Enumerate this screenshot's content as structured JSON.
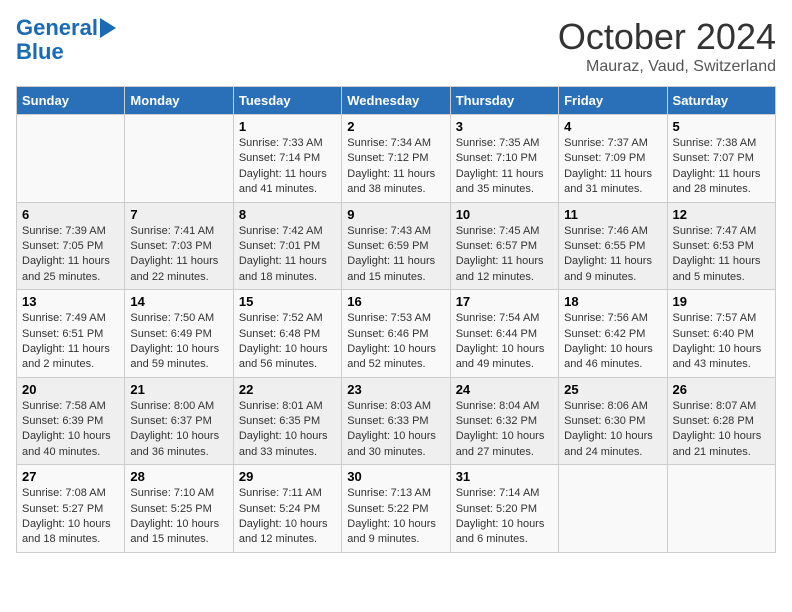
{
  "header": {
    "logo_line1": "General",
    "logo_line2": "Blue",
    "month": "October 2024",
    "location": "Mauraz, Vaud, Switzerland"
  },
  "days_of_week": [
    "Sunday",
    "Monday",
    "Tuesday",
    "Wednesday",
    "Thursday",
    "Friday",
    "Saturday"
  ],
  "weeks": [
    [
      {
        "day": "",
        "sunrise": "",
        "sunset": "",
        "daylight": ""
      },
      {
        "day": "",
        "sunrise": "",
        "sunset": "",
        "daylight": ""
      },
      {
        "day": "1",
        "sunrise": "Sunrise: 7:33 AM",
        "sunset": "Sunset: 7:14 PM",
        "daylight": "Daylight: 11 hours and 41 minutes."
      },
      {
        "day": "2",
        "sunrise": "Sunrise: 7:34 AM",
        "sunset": "Sunset: 7:12 PM",
        "daylight": "Daylight: 11 hours and 38 minutes."
      },
      {
        "day": "3",
        "sunrise": "Sunrise: 7:35 AM",
        "sunset": "Sunset: 7:10 PM",
        "daylight": "Daylight: 11 hours and 35 minutes."
      },
      {
        "day": "4",
        "sunrise": "Sunrise: 7:37 AM",
        "sunset": "Sunset: 7:09 PM",
        "daylight": "Daylight: 11 hours and 31 minutes."
      },
      {
        "day": "5",
        "sunrise": "Sunrise: 7:38 AM",
        "sunset": "Sunset: 7:07 PM",
        "daylight": "Daylight: 11 hours and 28 minutes."
      }
    ],
    [
      {
        "day": "6",
        "sunrise": "Sunrise: 7:39 AM",
        "sunset": "Sunset: 7:05 PM",
        "daylight": "Daylight: 11 hours and 25 minutes."
      },
      {
        "day": "7",
        "sunrise": "Sunrise: 7:41 AM",
        "sunset": "Sunset: 7:03 PM",
        "daylight": "Daylight: 11 hours and 22 minutes."
      },
      {
        "day": "8",
        "sunrise": "Sunrise: 7:42 AM",
        "sunset": "Sunset: 7:01 PM",
        "daylight": "Daylight: 11 hours and 18 minutes."
      },
      {
        "day": "9",
        "sunrise": "Sunrise: 7:43 AM",
        "sunset": "Sunset: 6:59 PM",
        "daylight": "Daylight: 11 hours and 15 minutes."
      },
      {
        "day": "10",
        "sunrise": "Sunrise: 7:45 AM",
        "sunset": "Sunset: 6:57 PM",
        "daylight": "Daylight: 11 hours and 12 minutes."
      },
      {
        "day": "11",
        "sunrise": "Sunrise: 7:46 AM",
        "sunset": "Sunset: 6:55 PM",
        "daylight": "Daylight: 11 hours and 9 minutes."
      },
      {
        "day": "12",
        "sunrise": "Sunrise: 7:47 AM",
        "sunset": "Sunset: 6:53 PM",
        "daylight": "Daylight: 11 hours and 5 minutes."
      }
    ],
    [
      {
        "day": "13",
        "sunrise": "Sunrise: 7:49 AM",
        "sunset": "Sunset: 6:51 PM",
        "daylight": "Daylight: 11 hours and 2 minutes."
      },
      {
        "day": "14",
        "sunrise": "Sunrise: 7:50 AM",
        "sunset": "Sunset: 6:49 PM",
        "daylight": "Daylight: 10 hours and 59 minutes."
      },
      {
        "day": "15",
        "sunrise": "Sunrise: 7:52 AM",
        "sunset": "Sunset: 6:48 PM",
        "daylight": "Daylight: 10 hours and 56 minutes."
      },
      {
        "day": "16",
        "sunrise": "Sunrise: 7:53 AM",
        "sunset": "Sunset: 6:46 PM",
        "daylight": "Daylight: 10 hours and 52 minutes."
      },
      {
        "day": "17",
        "sunrise": "Sunrise: 7:54 AM",
        "sunset": "Sunset: 6:44 PM",
        "daylight": "Daylight: 10 hours and 49 minutes."
      },
      {
        "day": "18",
        "sunrise": "Sunrise: 7:56 AM",
        "sunset": "Sunset: 6:42 PM",
        "daylight": "Daylight: 10 hours and 46 minutes."
      },
      {
        "day": "19",
        "sunrise": "Sunrise: 7:57 AM",
        "sunset": "Sunset: 6:40 PM",
        "daylight": "Daylight: 10 hours and 43 minutes."
      }
    ],
    [
      {
        "day": "20",
        "sunrise": "Sunrise: 7:58 AM",
        "sunset": "Sunset: 6:39 PM",
        "daylight": "Daylight: 10 hours and 40 minutes."
      },
      {
        "day": "21",
        "sunrise": "Sunrise: 8:00 AM",
        "sunset": "Sunset: 6:37 PM",
        "daylight": "Daylight: 10 hours and 36 minutes."
      },
      {
        "day": "22",
        "sunrise": "Sunrise: 8:01 AM",
        "sunset": "Sunset: 6:35 PM",
        "daylight": "Daylight: 10 hours and 33 minutes."
      },
      {
        "day": "23",
        "sunrise": "Sunrise: 8:03 AM",
        "sunset": "Sunset: 6:33 PM",
        "daylight": "Daylight: 10 hours and 30 minutes."
      },
      {
        "day": "24",
        "sunrise": "Sunrise: 8:04 AM",
        "sunset": "Sunset: 6:32 PM",
        "daylight": "Daylight: 10 hours and 27 minutes."
      },
      {
        "day": "25",
        "sunrise": "Sunrise: 8:06 AM",
        "sunset": "Sunset: 6:30 PM",
        "daylight": "Daylight: 10 hours and 24 minutes."
      },
      {
        "day": "26",
        "sunrise": "Sunrise: 8:07 AM",
        "sunset": "Sunset: 6:28 PM",
        "daylight": "Daylight: 10 hours and 21 minutes."
      }
    ],
    [
      {
        "day": "27",
        "sunrise": "Sunrise: 7:08 AM",
        "sunset": "Sunset: 5:27 PM",
        "daylight": "Daylight: 10 hours and 18 minutes."
      },
      {
        "day": "28",
        "sunrise": "Sunrise: 7:10 AM",
        "sunset": "Sunset: 5:25 PM",
        "daylight": "Daylight: 10 hours and 15 minutes."
      },
      {
        "day": "29",
        "sunrise": "Sunrise: 7:11 AM",
        "sunset": "Sunset: 5:24 PM",
        "daylight": "Daylight: 10 hours and 12 minutes."
      },
      {
        "day": "30",
        "sunrise": "Sunrise: 7:13 AM",
        "sunset": "Sunset: 5:22 PM",
        "daylight": "Daylight: 10 hours and 9 minutes."
      },
      {
        "day": "31",
        "sunrise": "Sunrise: 7:14 AM",
        "sunset": "Sunset: 5:20 PM",
        "daylight": "Daylight: 10 hours and 6 minutes."
      },
      {
        "day": "",
        "sunrise": "",
        "sunset": "",
        "daylight": ""
      },
      {
        "day": "",
        "sunrise": "",
        "sunset": "",
        "daylight": ""
      }
    ]
  ]
}
